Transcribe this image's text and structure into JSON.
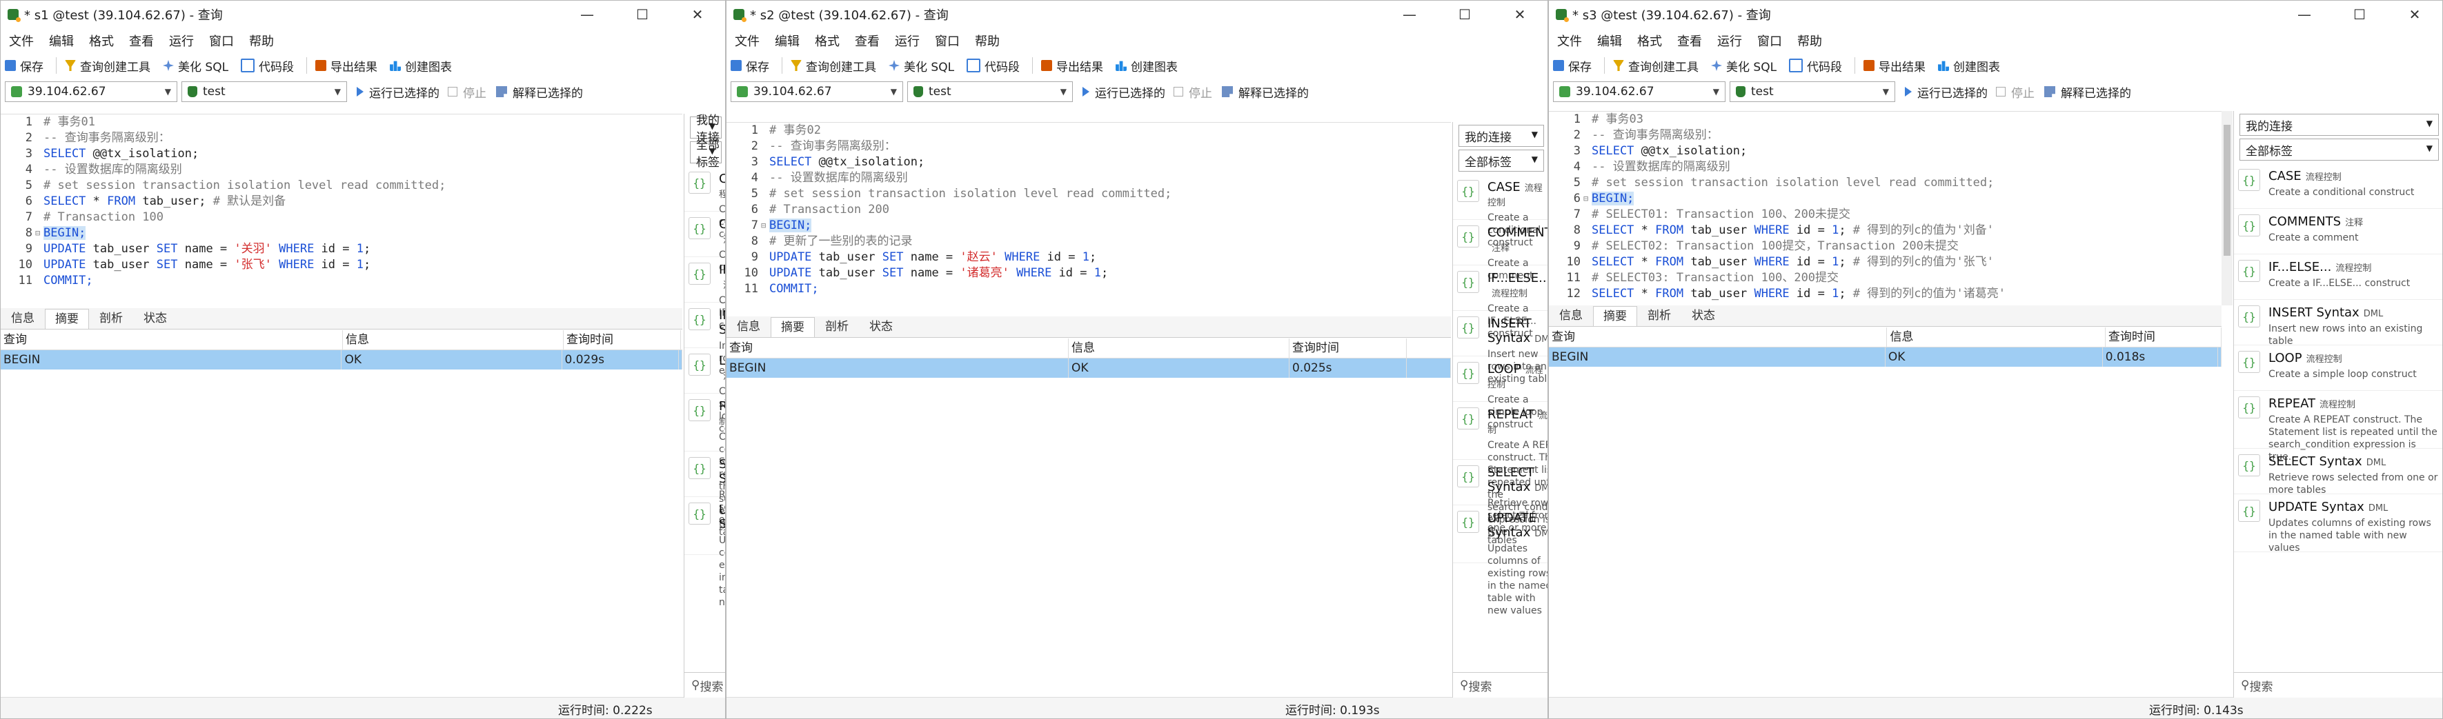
{
  "windows": [
    {
      "title": "* s1 @test (39.104.62.67) - 查询",
      "menu": [
        "文件",
        "编辑",
        "格式",
        "查看",
        "运行",
        "窗口",
        "帮助"
      ],
      "toolbar": {
        "save": "保存",
        "query_builder": "查询创建工具",
        "beautify": "美化 SQL",
        "snippet": "代码段",
        "export": "导出结果",
        "chart": "创建图表"
      },
      "connection": "39.104.62.67",
      "database": "test",
      "run_selected": "运行已选择的",
      "stop": "停止",
      "explain": "解释已选择的",
      "code_lines": [
        {
          "n": "1",
          "parts": [
            {
              "t": "# 事务01",
              "c": "cmt"
            }
          ]
        },
        {
          "n": "2",
          "parts": [
            {
              "t": "-- 查询事务隔离级别：",
              "c": "cmt"
            }
          ]
        },
        {
          "n": "3",
          "parts": [
            {
              "t": "SELECT",
              "c": "kw"
            },
            {
              "t": " @@tx_isolation;",
              "c": "fn"
            }
          ]
        },
        {
          "n": "4",
          "parts": [
            {
              "t": "-- 设置数据库的隔离级别",
              "c": "cmt"
            }
          ]
        },
        {
          "n": "5",
          "parts": [
            {
              "t": "# set session transaction isolation level read committed;",
              "c": "cmt"
            }
          ]
        },
        {
          "n": "6",
          "parts": [
            {
              "t": "SELECT",
              "c": "kw"
            },
            {
              "t": " * ",
              "c": "fn"
            },
            {
              "t": "FROM",
              "c": "kw"
            },
            {
              "t": " tab_user; ",
              "c": "fn"
            },
            {
              "t": "# 默认是刘备",
              "c": "cmt"
            }
          ]
        },
        {
          "n": "7",
          "parts": [
            {
              "t": "# Transaction 100",
              "c": "cmt"
            }
          ]
        },
        {
          "n": "8",
          "fold": "⊟",
          "hl": true,
          "parts": [
            {
              "t": "BEGIN;",
              "c": "kw"
            }
          ]
        },
        {
          "n": "9",
          "parts": [
            {
              "t": "UPDATE",
              "c": "kw"
            },
            {
              "t": " tab_user ",
              "c": "fn"
            },
            {
              "t": "SET",
              "c": "kw"
            },
            {
              "t": " name = ",
              "c": "fn"
            },
            {
              "t": "'关羽'",
              "c": "str"
            },
            {
              "t": " ",
              "c": "fn"
            },
            {
              "t": "WHERE",
              "c": "kw"
            },
            {
              "t": " id = ",
              "c": "fn"
            },
            {
              "t": "1",
              "c": "kw"
            },
            {
              "t": ";",
              "c": "fn"
            }
          ]
        },
        {
          "n": "10",
          "parts": [
            {
              "t": "UPDATE",
              "c": "kw"
            },
            {
              "t": " tab_user ",
              "c": "fn"
            },
            {
              "t": "SET",
              "c": "kw"
            },
            {
              "t": " name = ",
              "c": "fn"
            },
            {
              "t": "'张飞'",
              "c": "str"
            },
            {
              "t": " ",
              "c": "fn"
            },
            {
              "t": "WHERE",
              "c": "kw"
            },
            {
              "t": " id = ",
              "c": "fn"
            },
            {
              "t": "1",
              "c": "kw"
            },
            {
              "t": ";",
              "c": "fn"
            }
          ]
        },
        {
          "n": "11",
          "parts": [
            {
              "t": "COMMIT;",
              "c": "kw"
            }
          ]
        }
      ],
      "tabs": [
        "信息",
        "摘要",
        "剖析",
        "状态"
      ],
      "active_tab": "摘要",
      "columns": [
        "查询",
        "信息",
        "查询时间"
      ],
      "rows": [
        [
          "BEGIN",
          "OK",
          "0.029s"
        ]
      ],
      "runtime": "运行时间: 0.222s"
    },
    {
      "title": "* s2 @test (39.104.62.67) - 查询",
      "menu": [
        "文件",
        "编辑",
        "格式",
        "查看",
        "运行",
        "窗口",
        "帮助"
      ],
      "toolbar": {
        "save": "保存",
        "query_builder": "查询创建工具",
        "beautify": "美化 SQL",
        "snippet": "代码段",
        "export": "导出结果",
        "chart": "创建图表"
      },
      "connection": "39.104.62.67",
      "database": "test",
      "run_selected": "运行已选择的",
      "stop": "停止",
      "explain": "解释已选择的",
      "code_lines": [
        {
          "n": "1",
          "parts": [
            {
              "t": "# 事务02",
              "c": "cmt"
            }
          ]
        },
        {
          "n": "2",
          "parts": [
            {
              "t": "-- 查询事务隔离级别：",
              "c": "cmt"
            }
          ]
        },
        {
          "n": "3",
          "parts": [
            {
              "t": "SELECT",
              "c": "kw"
            },
            {
              "t": " @@tx_isolation;",
              "c": "fn"
            }
          ]
        },
        {
          "n": "4",
          "parts": [
            {
              "t": "-- 设置数据库的隔离级别",
              "c": "cmt"
            }
          ]
        },
        {
          "n": "5",
          "parts": [
            {
              "t": "# set session transaction isolation level read committed;",
              "c": "cmt"
            }
          ]
        },
        {
          "n": "6",
          "parts": [
            {
              "t": "# Transaction 200",
              "c": "cmt"
            }
          ]
        },
        {
          "n": "7",
          "fold": "⊟",
          "hl": true,
          "parts": [
            {
              "t": "BEGIN;",
              "c": "kw"
            }
          ]
        },
        {
          "n": "8",
          "parts": [
            {
              "t": "# 更新了一些别的表的记录",
              "c": "cmt"
            }
          ]
        },
        {
          "n": "9",
          "parts": [
            {
              "t": "UPDATE",
              "c": "kw"
            },
            {
              "t": " tab_user ",
              "c": "fn"
            },
            {
              "t": "SET",
              "c": "kw"
            },
            {
              "t": " name = ",
              "c": "fn"
            },
            {
              "t": "'赵云'",
              "c": "str"
            },
            {
              "t": " ",
              "c": "fn"
            },
            {
              "t": "WHERE",
              "c": "kw"
            },
            {
              "t": " id = ",
              "c": "fn"
            },
            {
              "t": "1",
              "c": "kw"
            },
            {
              "t": ";",
              "c": "fn"
            }
          ]
        },
        {
          "n": "10",
          "parts": [
            {
              "t": "UPDATE",
              "c": "kw"
            },
            {
              "t": " tab_user ",
              "c": "fn"
            },
            {
              "t": "SET",
              "c": "kw"
            },
            {
              "t": " name = ",
              "c": "fn"
            },
            {
              "t": "'诸葛亮'",
              "c": "str"
            },
            {
              "t": " ",
              "c": "fn"
            },
            {
              "t": "WHERE",
              "c": "kw"
            },
            {
              "t": " id = ",
              "c": "fn"
            },
            {
              "t": "1",
              "c": "kw"
            },
            {
              "t": ";",
              "c": "fn"
            }
          ]
        },
        {
          "n": "11",
          "parts": [
            {
              "t": "COMMIT;",
              "c": "kw"
            }
          ]
        }
      ],
      "tabs": [
        "信息",
        "摘要",
        "剖析",
        "状态"
      ],
      "active_tab": "摘要",
      "columns": [
        "查询",
        "信息",
        "查询时间"
      ],
      "rows": [
        [
          "BEGIN",
          "OK",
          "0.025s"
        ]
      ],
      "runtime": "运行时间: 0.193s"
    },
    {
      "title": "* s3 @test (39.104.62.67) - 查询",
      "menu": [
        "文件",
        "编辑",
        "格式",
        "查看",
        "运行",
        "窗口",
        "帮助"
      ],
      "toolbar": {
        "save": "保存",
        "query_builder": "查询创建工具",
        "beautify": "美化 SQL",
        "snippet": "代码段",
        "export": "导出结果",
        "chart": "创建图表"
      },
      "connection": "39.104.62.67",
      "database": "test",
      "run_selected": "运行已选择的",
      "stop": "停止",
      "explain": "解释已选择的",
      "code_lines": [
        {
          "n": "1",
          "parts": [
            {
              "t": "# 事务03",
              "c": "cmt"
            }
          ]
        },
        {
          "n": "2",
          "parts": [
            {
              "t": "-- 查询事务隔离级别：",
              "c": "cmt"
            }
          ]
        },
        {
          "n": "3",
          "parts": [
            {
              "t": "SELECT",
              "c": "kw"
            },
            {
              "t": " @@tx_isolation;",
              "c": "fn"
            }
          ]
        },
        {
          "n": "4",
          "parts": [
            {
              "t": "-- 设置数据库的隔离级别",
              "c": "cmt"
            }
          ]
        },
        {
          "n": "5",
          "parts": [
            {
              "t": "# set session transaction isolation level read committed;",
              "c": "cmt"
            }
          ]
        },
        {
          "n": "6",
          "fold": "⊟",
          "hl": true,
          "parts": [
            {
              "t": "BEGIN;",
              "c": "kw"
            }
          ]
        },
        {
          "n": "7",
          "parts": [
            {
              "t": "# SELECT01: Transaction 100、200未提交",
              "c": "cmt"
            }
          ]
        },
        {
          "n": "8",
          "parts": [
            {
              "t": "SELECT",
              "c": "kw"
            },
            {
              "t": " * ",
              "c": "fn"
            },
            {
              "t": "FROM",
              "c": "kw"
            },
            {
              "t": " tab_user ",
              "c": "fn"
            },
            {
              "t": "WHERE",
              "c": "kw"
            },
            {
              "t": " id = ",
              "c": "fn"
            },
            {
              "t": "1",
              "c": "kw"
            },
            {
              "t": "; ",
              "c": "fn"
            },
            {
              "t": "# 得到的列c的值为'刘备'",
              "c": "cmt"
            }
          ]
        },
        {
          "n": "9",
          "parts": [
            {
              "t": "# SELECT02: Transaction 100提交，Transaction 200未提交",
              "c": "cmt"
            }
          ]
        },
        {
          "n": "10",
          "parts": [
            {
              "t": "SELECT",
              "c": "kw"
            },
            {
              "t": " * ",
              "c": "fn"
            },
            {
              "t": "FROM",
              "c": "kw"
            },
            {
              "t": " tab_user ",
              "c": "fn"
            },
            {
              "t": "WHERE",
              "c": "kw"
            },
            {
              "t": " id = ",
              "c": "fn"
            },
            {
              "t": "1",
              "c": "kw"
            },
            {
              "t": "; ",
              "c": "fn"
            },
            {
              "t": "# 得到的列c的值为'张飞'",
              "c": "cmt"
            }
          ]
        },
        {
          "n": "11",
          "parts": [
            {
              "t": "# SELECT03: Transaction 100、200提交",
              "c": "cmt"
            }
          ]
        },
        {
          "n": "12",
          "parts": [
            {
              "t": "SELECT",
              "c": "kw"
            },
            {
              "t": " * ",
              "c": "fn"
            },
            {
              "t": "FROM",
              "c": "kw"
            },
            {
              "t": " tab_user ",
              "c": "fn"
            },
            {
              "t": "WHERE",
              "c": "kw"
            },
            {
              "t": " id = ",
              "c": "fn"
            },
            {
              "t": "1",
              "c": "kw"
            },
            {
              "t": "; ",
              "c": "fn"
            },
            {
              "t": "# 得到的列c的值为'诸葛亮'",
              "c": "cmt"
            }
          ]
        }
      ],
      "tabs": [
        "信息",
        "摘要",
        "剖析",
        "状态"
      ],
      "active_tab": "摘要",
      "columns": [
        "查询",
        "信息",
        "查询时间"
      ],
      "rows": [
        [
          "BEGIN",
          "OK",
          "0.018s"
        ]
      ],
      "runtime": "运行时间: 0.143s"
    }
  ],
  "sidebar": {
    "connection_select": "我的连接",
    "tag_select": "全部标签",
    "search_placeholder": "搜索",
    "snippets": [
      {
        "name": "CASE",
        "tag": "流程控制",
        "desc": "Create a conditional construct"
      },
      {
        "name": "COMMENTS",
        "tag": "注释",
        "desc": "Create a comment"
      },
      {
        "name": "IF...ELSE...",
        "tag": "流程控制",
        "desc": "Create a IF...ELSE... construct"
      },
      {
        "name": "INSERT Syntax",
        "tag": "DML",
        "desc": "Insert new rows into an existing table"
      },
      {
        "name": "LOOP",
        "tag": "流程控制",
        "desc": "Create a simple loop construct"
      },
      {
        "name": "REPEAT",
        "tag": "流程控制",
        "desc": "Create A REPEAT construct. The Statement list is repeated until the search_condition expression is true."
      },
      {
        "name": "SELECT Syntax",
        "tag": "DML",
        "desc": "Retrieve rows selected from one or more tables"
      },
      {
        "name": "UPDATE Syntax",
        "tag": "DML",
        "desc": "Updates columns of existing rows in the named table with new values"
      }
    ]
  },
  "window_controls": {
    "minimize": "—",
    "maximize": "☐",
    "close": "✕"
  }
}
